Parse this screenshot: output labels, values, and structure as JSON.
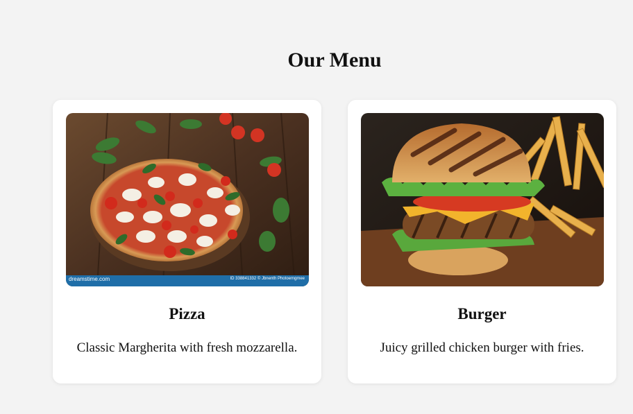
{
  "menu": {
    "title": "Our Menu",
    "items": [
      {
        "name": "Pizza",
        "description": "Classic Margherita with fresh mozzarella.",
        "image": "pizza-photo",
        "watermark": {
          "site": "dreamstime.com",
          "credit": "ID 338841332 © Jbnenth Photoemgmee"
        }
      },
      {
        "name": "Burger",
        "description": "Juicy grilled chicken burger with fries.",
        "image": "burger-photo"
      }
    ]
  },
  "colors": {
    "background": "#f3f3f3",
    "card": "#ffffff",
    "watermark_bar": "#1f6ea8"
  }
}
